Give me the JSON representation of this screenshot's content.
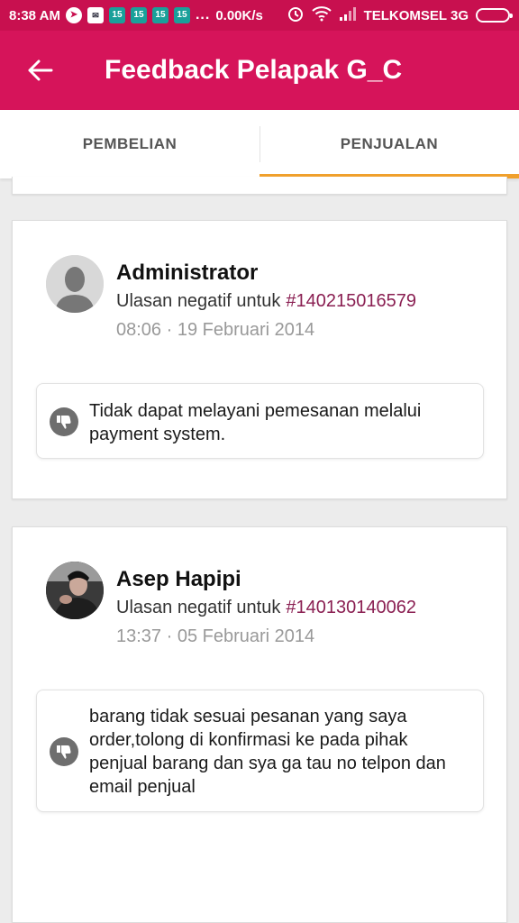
{
  "status_bar": {
    "time": "8:38 AM",
    "notification_icons": [
      "telegram-icon",
      "mail-icon",
      "calendar-15-icon",
      "calendar-15-icon",
      "calendar-15-icon",
      "calendar-15-icon"
    ],
    "calendar_day": "15",
    "more_dots": "...",
    "network_speed": "0.00K/s",
    "carrier": "TELKOMSEL 3G"
  },
  "app_bar": {
    "back_icon": "arrow-left-icon",
    "title": "Feedback Pelapak G_C"
  },
  "tabs": [
    {
      "label": "PEMBELIAN",
      "active": false
    },
    {
      "label": "PENJUALAN",
      "active": true
    }
  ],
  "colors": {
    "status_bar": "#c8104f",
    "app_bar": "#d6145a",
    "tab_indicator": "#f0a02c",
    "order_link": "#8a1f52"
  },
  "reviews": [
    {
      "name": "Administrator",
      "review_prefix": "Ulasan negatif untuk",
      "order_id": "#140215016579",
      "timestamp": "08:06 · 19 Februari 2014",
      "rating_icon": "thumbs-down-icon",
      "comment": "Tidak dapat melayani pemesanan melalui payment system."
    },
    {
      "name": "Asep Hapipi",
      "review_prefix": "Ulasan negatif untuk",
      "order_id": "#140130140062",
      "timestamp": "13:37 · 05 Februari 2014",
      "rating_icon": "thumbs-down-icon",
      "comment": "barang tidak sesuai pesanan yang saya order,tolong di konfirmasi ke pada pihak penjual barang dan sya ga tau no telpon dan email penjual"
    }
  ]
}
